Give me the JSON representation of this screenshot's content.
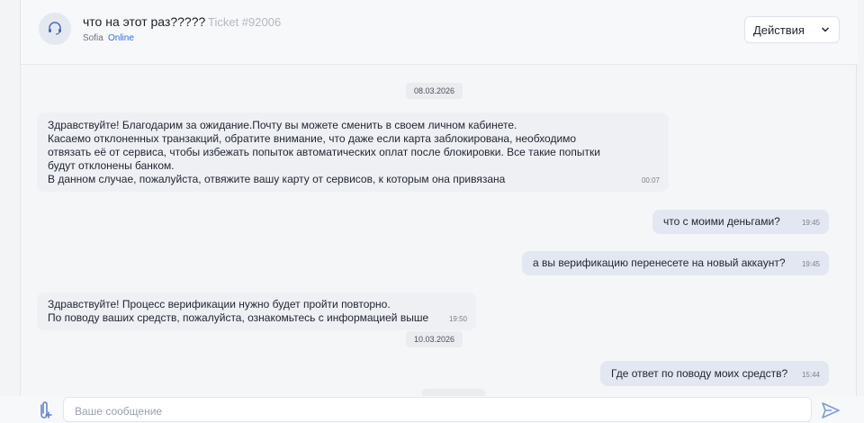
{
  "header": {
    "title": "что на этот раз?????",
    "ticket": "Ticket #92006",
    "agent_name": "Sofia",
    "status": "Online",
    "actions_label": "Действия"
  },
  "messages": {
    "date1": "08.03.2026",
    "m1": {
      "lines": [
        "Здравствуйте! Благодарим за ожидание.Почту вы можете сменить в своем личном кабинете.",
        "Касаемо отклоненных транзакций, обратите внимание, что даже если карта заблокирована, необходимо",
        "отвязать её от сервиса, чтобы избежать попыток автоматических оплат после блокировки. Все такие попытки",
        "будут отклонены банком.",
        "В данном случае, пожалуйста, отвяжите вашу карту от сервисов, к которым она привязана"
      ],
      "time": "00:07"
    },
    "m2": {
      "text": "что с моими деньгами?",
      "time": "19:45"
    },
    "m3": {
      "text": "а вы верификацию перенесете на новый аккаунт?",
      "time": "19:45"
    },
    "m4": {
      "lines": [
        "Здравствуйте! Процесс верификации нужно будет пройти повторно.",
        "По поводу ваших средств, пожалуйста, ознакомьтесь с информацией выше"
      ],
      "time": "19:50"
    },
    "date2": "10.03.2026",
    "m5": {
      "text": "Где ответ по поводу моих средств?",
      "time": "15:44"
    }
  },
  "composer": {
    "placeholder": "Ваше сообщение"
  },
  "icons": {
    "avatar": "support-agent-icon",
    "attach": "paperclip-icon",
    "send": "send-icon",
    "dropdown": "chevron-down-icon"
  },
  "colors": {
    "accent": "#2f6fd6",
    "incoming_bubble": "#eef0f3",
    "outgoing_bubble": "#e2e7f1"
  }
}
